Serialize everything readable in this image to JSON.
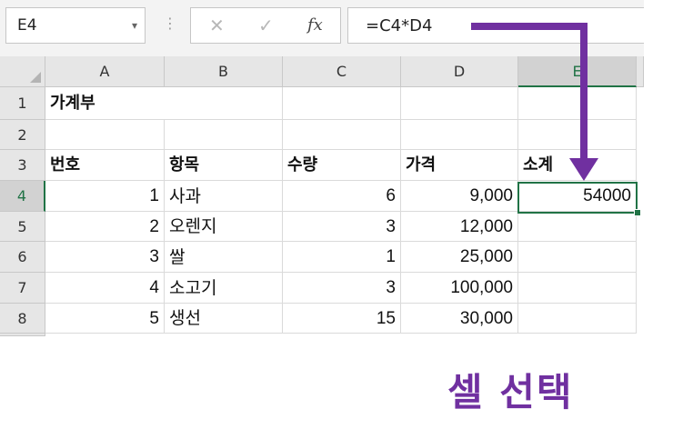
{
  "formula_bar": {
    "name_box": "E4",
    "dropdown_icon": "▾",
    "separator_icon": "⋮",
    "cancel_icon": "✕",
    "enter_icon": "✓",
    "fx_icon": "fx",
    "formula": "=C4*D4"
  },
  "columns": [
    "A",
    "B",
    "C",
    "D",
    "E"
  ],
  "rows": [
    "1",
    "2",
    "3",
    "4",
    "5",
    "6",
    "7",
    "8"
  ],
  "cells": {
    "A1": "가계부",
    "A3": "번호",
    "B3": "항목",
    "C3": "수량",
    "D3": "가격",
    "E3": "소계",
    "A4": "1",
    "B4": "사과",
    "C4": "6",
    "D4": "9,000",
    "E4": "54000",
    "A5": "2",
    "B5": "오렌지",
    "C5": "3",
    "D5": "12,000",
    "A6": "3",
    "B6": "쌀",
    "C6": "1",
    "D6": "25,000",
    "A7": "4",
    "B7": "소고기",
    "C7": "3",
    "D7": "100,000",
    "A8": "5",
    "B8": "생선",
    "C8": "15",
    "D8": "30,000"
  },
  "selection": {
    "cell": "E4",
    "border_color": "#217346"
  },
  "annotation": {
    "text": "셀 선택",
    "color": "#7030a0"
  }
}
